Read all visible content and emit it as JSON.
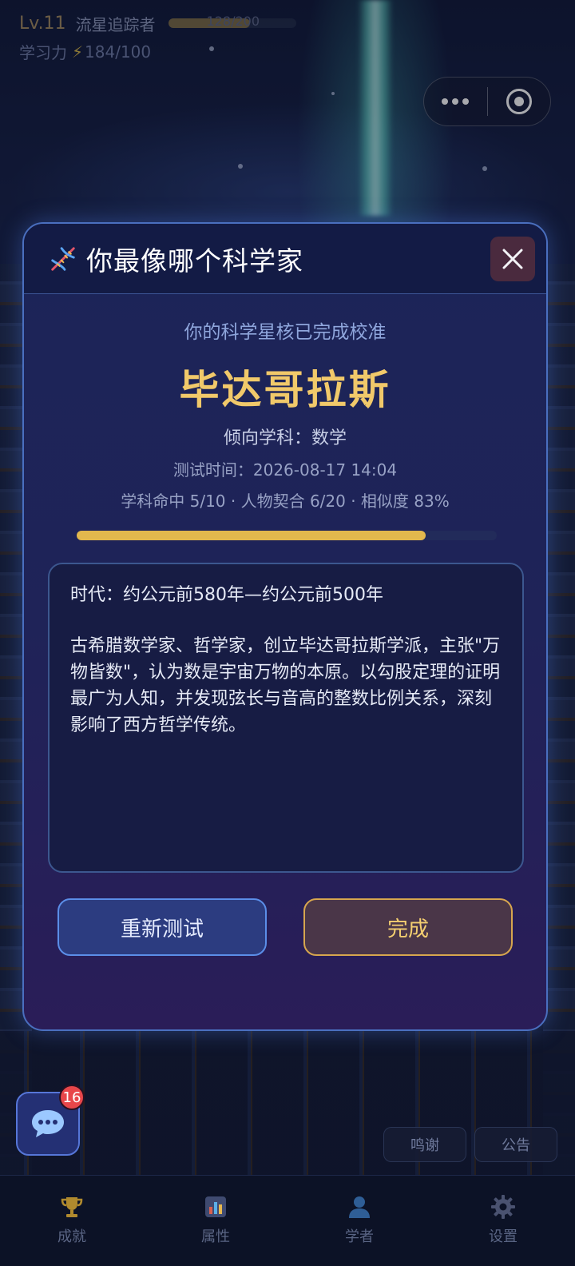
{
  "status": {
    "level": "Lv.11",
    "rank_title": "流星追踪者",
    "xp_text": "128/200",
    "xp_fraction": 0.64,
    "power_label": "学习力",
    "power_value": "184/100"
  },
  "modal": {
    "title": "你最像哪个科学家",
    "subtitle": "你的科学星核已完成校准",
    "result_name": "毕达哥拉斯",
    "subject_line": "倾向学科：数学",
    "test_time": "测试时间：2026-08-17 14:04",
    "stats_line": "学科命中 5/10  ·  人物契合 6/20  ·  相似度 83%",
    "similarity_fraction": 0.83,
    "era": "时代：约公元前580年—约公元前500年",
    "description": "古希腊数学家、哲学家，创立毕达哥拉斯学派，主张\"万物皆数\"，认为数是宇宙万物的本原。以勾股定理的证明最广为人知，并发现弦长与音高的整数比例关系，深刻影响了西方哲学传统。",
    "retest_label": "重新测试",
    "done_label": "完成"
  },
  "chat": {
    "badge_count": "16"
  },
  "side_buttons": {
    "thanks": "鸣谢",
    "notice": "公告"
  },
  "tabs": [
    {
      "label": "成就",
      "icon": "trophy-icon"
    },
    {
      "label": "属性",
      "icon": "bar-chart-icon"
    },
    {
      "label": "学者",
      "icon": "person-icon"
    },
    {
      "label": "设置",
      "icon": "gear-icon"
    }
  ],
  "colors": {
    "accent_gold": "#f1c96a",
    "accent_blue": "#5b8ee8",
    "badge_red": "#e8464a"
  }
}
